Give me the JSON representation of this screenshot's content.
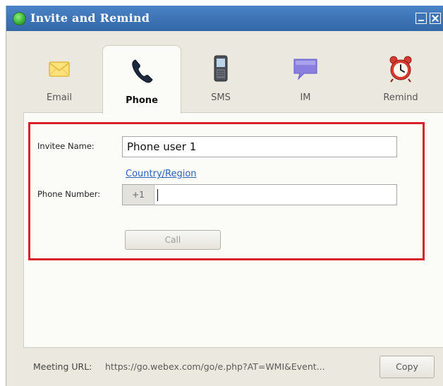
{
  "window": {
    "title": "Invite and Remind"
  },
  "tabs": [
    {
      "label": "Email",
      "icon": "envelope-icon",
      "active": false
    },
    {
      "label": "Phone",
      "icon": "phone-handset-icon",
      "active": true
    },
    {
      "label": "SMS",
      "icon": "mobile-phone-icon",
      "active": false
    },
    {
      "label": "IM",
      "icon": "chat-bubble-icon",
      "active": false
    },
    {
      "label": "Remind",
      "icon": "alarm-clock-icon",
      "active": false
    }
  ],
  "form": {
    "invitee_label": "Invitee Name:",
    "invitee_value": "Phone user 1",
    "country_link": "Country/Region",
    "phone_label": "Phone Number:",
    "phone_prefix": "+1",
    "phone_value": "",
    "call_button": "Call"
  },
  "footer": {
    "meeting_url_label": "Meeting URL:",
    "meeting_url_value": "https://go.webex.com/go/e.php?AT=WMI&Event...",
    "copy_button": "Copy"
  },
  "colors": {
    "titlebar": "#3f76b8",
    "highlight_border": "#d8232a",
    "link": "#2a5fb8"
  }
}
